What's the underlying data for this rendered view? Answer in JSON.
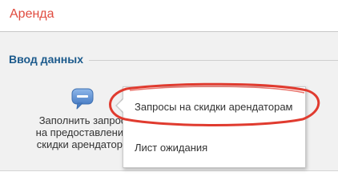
{
  "header": {
    "title": "Аренда"
  },
  "section": {
    "title": "Ввод данных"
  },
  "tile": {
    "icon": "speech-bubble-icon",
    "lines": [
      "Заполнить запрос",
      "на предоставление",
      "скидки арендатора"
    ]
  },
  "popup_menu": {
    "items": [
      "Запросы на скидки арендаторам",
      "Лист ожидания"
    ]
  },
  "colors": {
    "header_title": "#e04b3f",
    "section_title": "#1c5a8c",
    "annotation_ellipse": "#e03b2f",
    "icon_fill": "#5b8fd0"
  }
}
